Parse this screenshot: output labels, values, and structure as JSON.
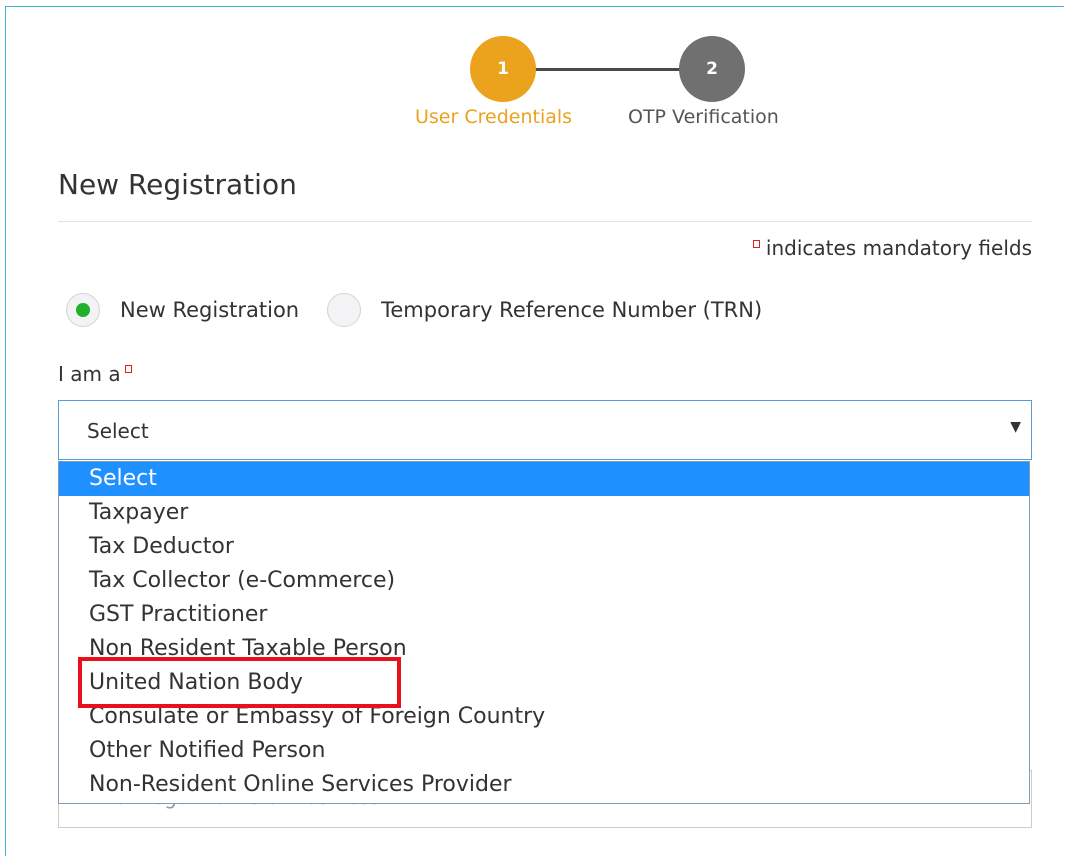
{
  "stepper": {
    "steps": [
      {
        "number": "1",
        "label": "User Credentials"
      },
      {
        "number": "2",
        "label": "OTP Verification"
      }
    ]
  },
  "page_title": "New Registration",
  "mandatory_note": "indicates mandatory fields",
  "radio_options": [
    {
      "label": "New Registration",
      "checked": true
    },
    {
      "label": "Temporary Reference Number (TRN)",
      "checked": false
    }
  ],
  "role_field": {
    "label": "I am a",
    "value": "Select",
    "options": [
      "Select",
      "Taxpayer",
      "Tax Deductor",
      "Tax Collector (e-Commerce)",
      "GST Practitioner",
      "Non Resident Taxable Person",
      "United Nation Body",
      "Consulate or Embassy of Foreign Country",
      "Other Notified Person",
      "Non-Resident Online Services Provider"
    ],
    "highlighted_option": "United Nation Body"
  },
  "legal_name_field": {
    "placeholder": "Enter Legal Name of Business"
  },
  "colors": {
    "accent": "#eba21c",
    "selected_option_bg": "#1e90ff",
    "radio_checked": "#21b02b",
    "highlight_border": "#e8101a"
  }
}
